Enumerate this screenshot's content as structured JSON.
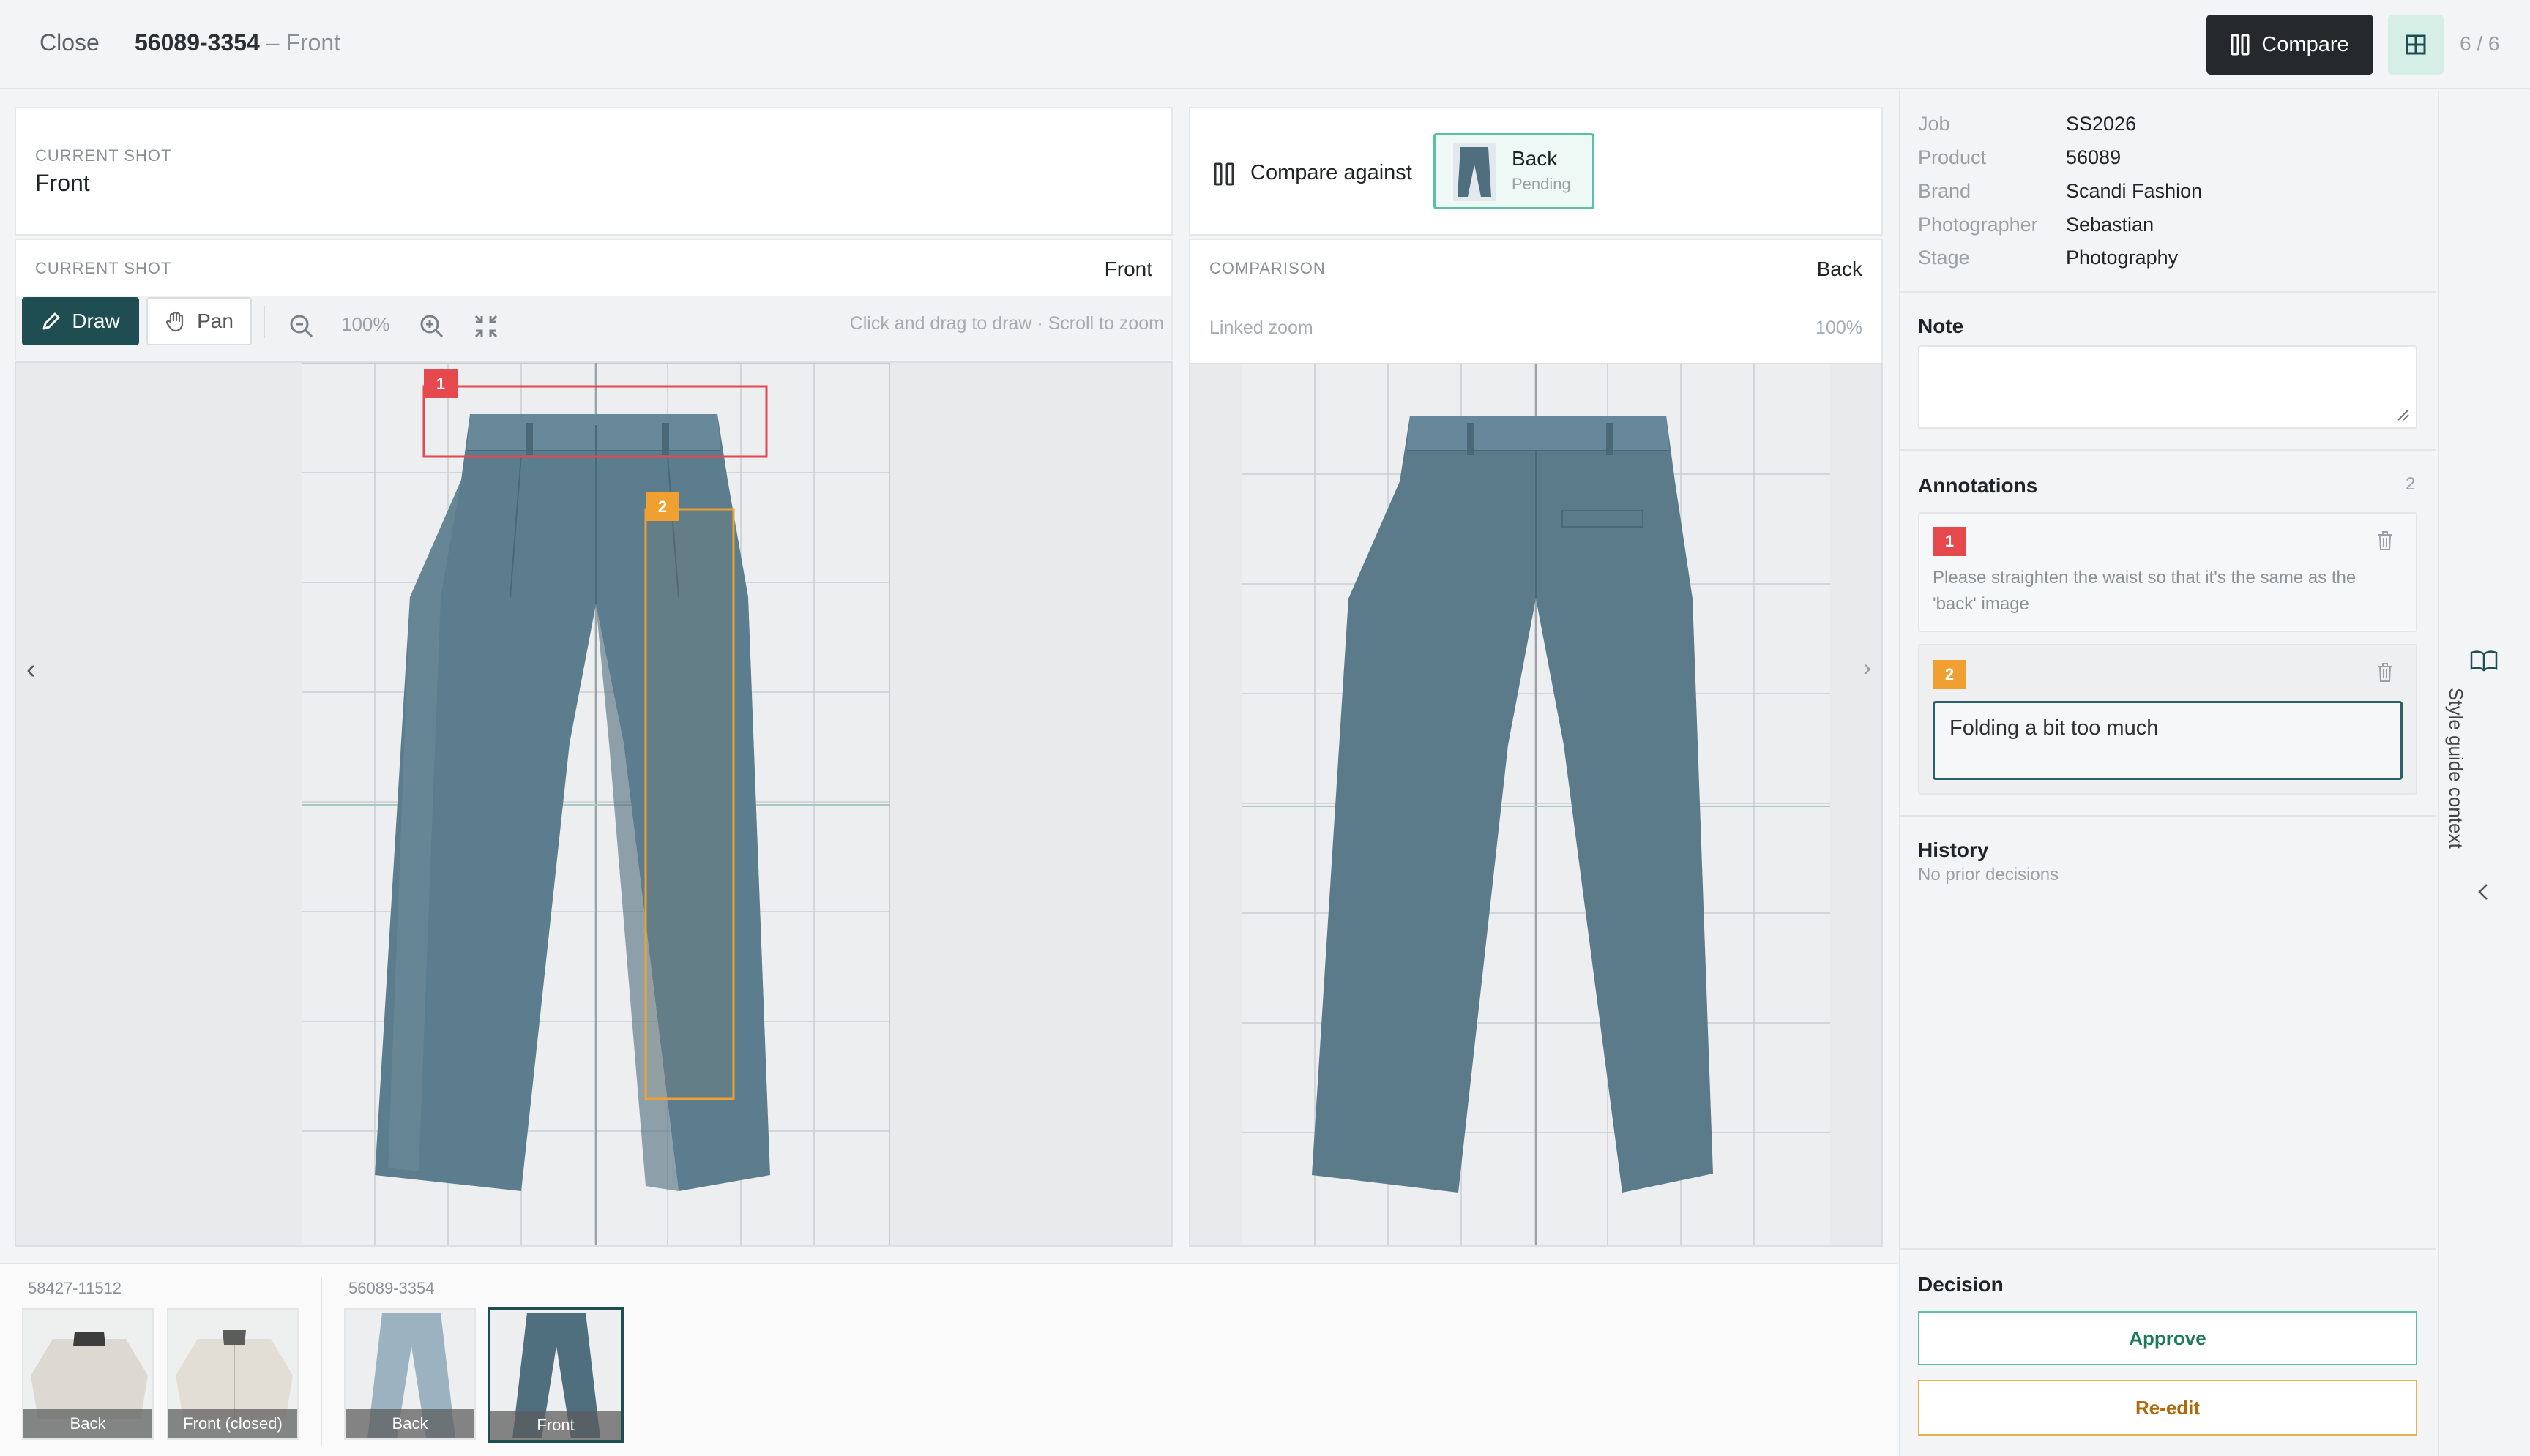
{
  "topbar": {
    "close_label": "Close",
    "shot_id": "56089-3354",
    "shot_suffix": " – Front",
    "compare_label": "Compare",
    "counter": "6 / 6"
  },
  "current_shot": {
    "caption": "Current shot",
    "name": "Front",
    "header_caption": "Current shot",
    "header_value": "Front"
  },
  "toolbar": {
    "draw_label": "Draw",
    "pan_label": "Pan",
    "zoom": "100%",
    "hint": "Click and drag to draw · Scroll to zoom"
  },
  "compare": {
    "against_label": "Compare against",
    "chip_title": "Back",
    "chip_status": "Pending",
    "header_caption": "Comparison",
    "header_value": "Back",
    "linked_label": "Linked zoom",
    "linked_value": "100%"
  },
  "meta": [
    {
      "key": "Job",
      "value": "SS2026"
    },
    {
      "key": "Product",
      "value": "56089"
    },
    {
      "key": "Brand",
      "value": "Scandi Fashion"
    },
    {
      "key": "Photographer",
      "value": "Sebastian"
    },
    {
      "key": "Stage",
      "value": "Photography"
    }
  ],
  "note": {
    "title": "Note",
    "value": ""
  },
  "annotations": {
    "title": "Annotations",
    "count": "2",
    "items": [
      {
        "number": "1",
        "color": "#e5484d",
        "text_line1": "Please straighten the waist so that it's the same as the",
        "text_line2": "'back' image"
      },
      {
        "number": "2",
        "color": "#f0a030",
        "input_value": "Folding a bit too much"
      }
    ]
  },
  "history": {
    "title": "History",
    "value": "No prior decisions"
  },
  "decision": {
    "title": "Decision",
    "approve_label": "Approve",
    "reedit_label": "Re-edit"
  },
  "style_guide": {
    "label": "Style guide context"
  },
  "canvas": {
    "prev_arrow": "‹",
    "next_arrow": "›"
  },
  "filmstrip": {
    "groups": [
      {
        "label": "58427-11512",
        "thumbs": [
          {
            "caption": "Back"
          },
          {
            "caption": "Front (closed)"
          }
        ]
      },
      {
        "label": "56089-3354",
        "thumbs": [
          {
            "caption": "Back"
          },
          {
            "caption": "Front"
          }
        ]
      }
    ]
  },
  "colors": {
    "accent": "#1e4d52",
    "compare_chip_border": "#59c2a6",
    "annotation_1": "#e5484d",
    "annotation_2": "#f0a030",
    "approve": "#1f7a5c",
    "reedit": "#b06a0a",
    "garment": "#5c7d8d"
  }
}
